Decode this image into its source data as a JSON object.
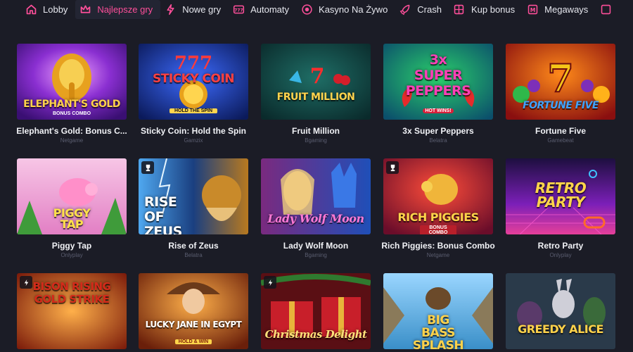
{
  "nav": {
    "items": [
      {
        "label": "Lobby",
        "icon": "home-icon"
      },
      {
        "label": "Najlepsze gry",
        "icon": "crown-icon",
        "active": true
      },
      {
        "label": "Nowe gry",
        "icon": "lightning-icon"
      },
      {
        "label": "Automaty",
        "icon": "slot-777-icon"
      },
      {
        "label": "Kasyno Na Żywo",
        "icon": "live-icon"
      },
      {
        "label": "Crash",
        "icon": "rocket-icon"
      },
      {
        "label": "Kup bonus",
        "icon": "bonus-icon"
      },
      {
        "label": "Megaways",
        "icon": "megaways-icon"
      }
    ],
    "accent": "#ff4f9a"
  },
  "games": [
    {
      "name": "Elephant's Gold: Bonus C...",
      "provider": "Netgame",
      "art_title": "ELEPHANT'S GOLD",
      "art_sub": "BONUS COMBO"
    },
    {
      "name": "Sticky Coin: Hold the Spin",
      "provider": "Gamzix",
      "art_title": "STICKY COIN",
      "art_sub": "HOLD THE SPIN"
    },
    {
      "name": "Fruit Million",
      "provider": "Bgaming",
      "art_title": "FRUIT MILLION",
      "art_sub": ""
    },
    {
      "name": "3x Super Peppers",
      "provider": "Belatra",
      "art_title": "3x SUPER PEPPERS",
      "art_sub": "HOT WINS!"
    },
    {
      "name": "Fortune Five",
      "provider": "Gamebeat",
      "art_title": "FORTUNE FIVE",
      "art_sub": ""
    },
    {
      "name": "Piggy Tap",
      "provider": "Onlyplay",
      "art_title": "PIGGY TAP",
      "art_sub": ""
    },
    {
      "name": "Rise of Zeus",
      "provider": "Belatra",
      "art_title": "RISE OF ZEUS",
      "art_sub": "",
      "badge": "trophy-icon"
    },
    {
      "name": "Lady Wolf Moon",
      "provider": "Bgaming",
      "art_title": "Lady Wolf Moon",
      "art_sub": ""
    },
    {
      "name": "Rich Piggies: Bonus Combo",
      "provider": "Netgame",
      "art_title": "RICH PIGGIES",
      "art_sub": "BONUS COMBO",
      "badge": "trophy-icon"
    },
    {
      "name": "Retro Party",
      "provider": "Onlyplay",
      "art_title": "RETRO PARTY",
      "art_sub": ""
    },
    {
      "name": "",
      "provider": "",
      "art_title": "BISON RISING GOLD STRIKE",
      "art_sub": "",
      "badge": "lightning-icon"
    },
    {
      "name": "",
      "provider": "",
      "art_title": "LUCKY JANE IN EGYPT",
      "art_sub": "HOLD & WIN"
    },
    {
      "name": "",
      "provider": "",
      "art_title": "Christmas Delight",
      "art_sub": "",
      "badge": "lightning-icon"
    },
    {
      "name": "",
      "provider": "",
      "art_title": "BIG BASS SPLASH",
      "art_sub": ""
    },
    {
      "name": "",
      "provider": "",
      "art_title": "GREEDY ALICE",
      "art_sub": ""
    }
  ]
}
